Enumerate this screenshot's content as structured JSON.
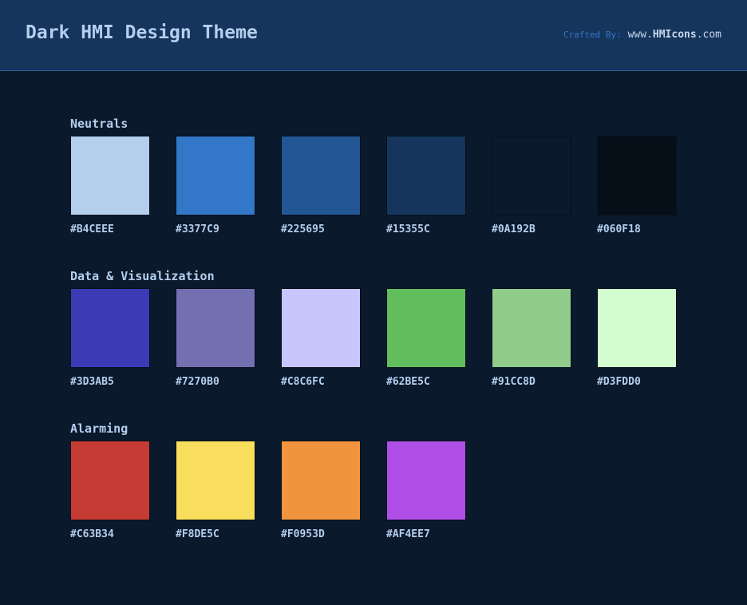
{
  "header": {
    "title": "Dark HMI Design Theme",
    "credit_label": "Crafted By:",
    "credit_site_prefix": "www.",
    "credit_site_brand": "HMIcons",
    "credit_site_suffix": ".com"
  },
  "sections": [
    {
      "title": "Neutrals",
      "colors": [
        "#B4CEEE",
        "#3377C9",
        "#225695",
        "#15355C",
        "#0A192B",
        "#060F18"
      ]
    },
    {
      "title": "Data & Visualization",
      "colors": [
        "#3D3AB5",
        "#7270B0",
        "#C8C6FC",
        "#62BE5C",
        "#91CC8D",
        "#D3FDD0"
      ]
    },
    {
      "title": "Alarming",
      "colors": [
        "#C63B34",
        "#F8DE5C",
        "#F0953D",
        "#AF4EE7"
      ]
    }
  ]
}
